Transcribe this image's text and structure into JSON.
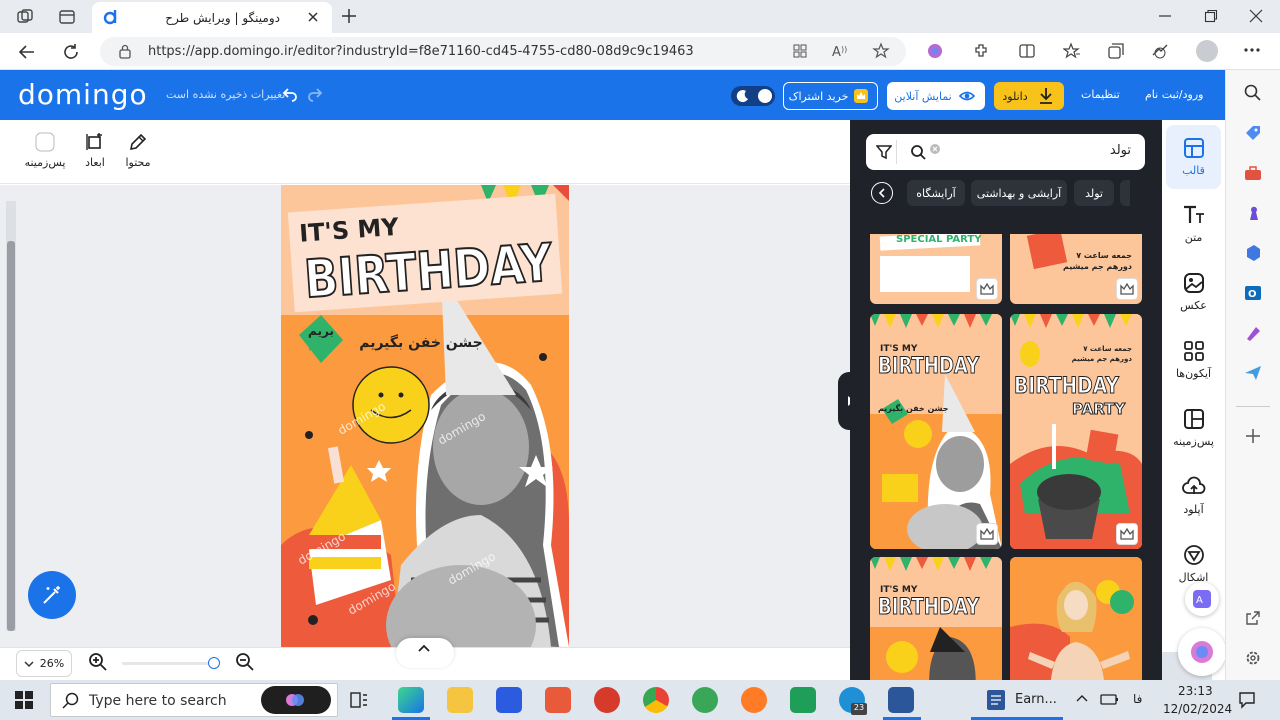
{
  "browser": {
    "tab_title": "دومینگو | ویرایش طرح",
    "url": "https://app.domingo.ir/editor?industryId=f8e71160-cd45-4755-cd80-08d9c9c19463"
  },
  "header": {
    "logo": "domingo",
    "unsaved_text": "تغییرات ذخیره نشده است",
    "subscribe_label": "خرید اشتراک",
    "preview_label": "نمایش آنلاین",
    "download_label": "دانلود",
    "settings_label": "تنظیمات",
    "login_label": "ورود/ثبت نام"
  },
  "toolbar": {
    "background_label": "پس‌زمینه",
    "dimensions_label": "ابعاد",
    "content_label": "محتوا"
  },
  "design": {
    "line1": "IT'S MY",
    "line2": "BIRTHDAY",
    "persian": "جشن خفن بگیریم",
    "persian_small": "بریم",
    "watermark": "domingo"
  },
  "zoom": {
    "level": "26%"
  },
  "panel": {
    "search_value": "تولد",
    "chips": [
      "تولد",
      "آرایشی و بهداشتی",
      "آرایشگاه"
    ],
    "thumbs": [
      {
        "title": "SPECIAL PARTY",
        "sub": ""
      },
      {
        "title": "جمعه ساعت ۷ دورهم جم میشیم",
        "sub": ""
      },
      {
        "title": "IT'S MY",
        "sub": "BIRTHDAY"
      },
      {
        "title": "BIRTHDAY",
        "sub": "PARTY"
      },
      {
        "title": "IT'S MY",
        "sub": "BIRTHDAY"
      },
      {
        "title": "",
        "sub": ""
      }
    ],
    "thumb_caption_party": "جمعه ساعت ۷ دورهم جم میشیم",
    "thumb_caption_fun": "جشن خفن بگیریم"
  },
  "rail": {
    "items": [
      "قالب",
      "متن",
      "عکس",
      "آیکون‌ها",
      "پس‌زمینه",
      "آپلود",
      "اشکال"
    ]
  },
  "taskbar": {
    "search_placeholder": "Type here to search",
    "word_label": "Earn...",
    "lang": "فا",
    "time": "23:13",
    "date": "12/02/2024",
    "badge": "23"
  },
  "colors": {
    "brand_blue": "#1a73e8",
    "download_yellow": "#f9c21b",
    "panel_dark": "#1f2228",
    "design_orange": "#fb9a3e"
  }
}
